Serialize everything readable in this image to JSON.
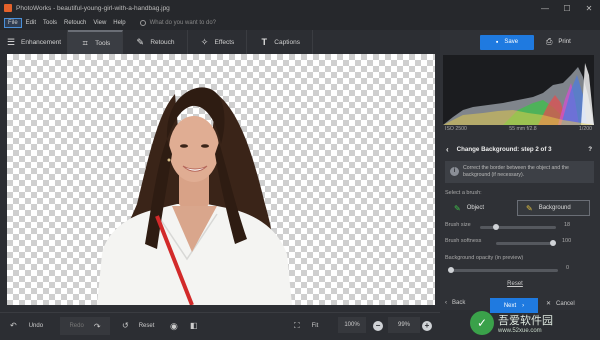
{
  "window": {
    "title": "PhotoWorks - beautiful-young-girl-with-a-handbag.jpg",
    "minimize": "—",
    "maximize": "☐",
    "close": "✕"
  },
  "menu": {
    "items": [
      "File",
      "Edit",
      "Tools",
      "Retouch",
      "View",
      "Help"
    ],
    "search_placeholder": "What do you want to do?"
  },
  "tabs": [
    {
      "label": "Enhancement",
      "icon": "sliders-icon",
      "glyph": "☰"
    },
    {
      "label": "Tools",
      "icon": "crop-icon",
      "glyph": "⌗"
    },
    {
      "label": "Retouch",
      "icon": "brush-icon",
      "glyph": "✎"
    },
    {
      "label": "Effects",
      "icon": "wand-icon",
      "glyph": "✧"
    },
    {
      "label": "Captions",
      "icon": "text-icon",
      "glyph": "T"
    }
  ],
  "actions": {
    "save": "Save",
    "print": "Print"
  },
  "histogram_info": {
    "iso": "ISO 2500",
    "lens": "55 mm f/2.8",
    "shutter": "1/200"
  },
  "panel": {
    "step_title": "Change Background: step 2 of 3",
    "help": "?",
    "info_text": "Correct the border between the object and the background (if necessary).",
    "select_brush_label": "Select a brush:",
    "object_label": "Object",
    "background_label": "Background",
    "brush_size_label": "Brush size",
    "brush_size_value": "18",
    "brush_size_level": 0.18,
    "brush_softness_label": "Brush softness",
    "brush_softness_value": "100",
    "brush_softness_level": 1.0,
    "bg_opacity_label": "Background opacity (in preview)",
    "bg_opacity_value": "0",
    "bg_opacity_level": 0,
    "reset": "Reset",
    "back": "Back",
    "next": "Next",
    "cancel": "Cancel"
  },
  "bottom": {
    "undo": "Undo",
    "redo": "Redo",
    "reset": "Reset",
    "fit": "Fit",
    "zoom_preset": "100%",
    "zoom_value": "99%"
  },
  "watermark": {
    "title": "吾爱软件园",
    "url": "www.52xue.com"
  }
}
